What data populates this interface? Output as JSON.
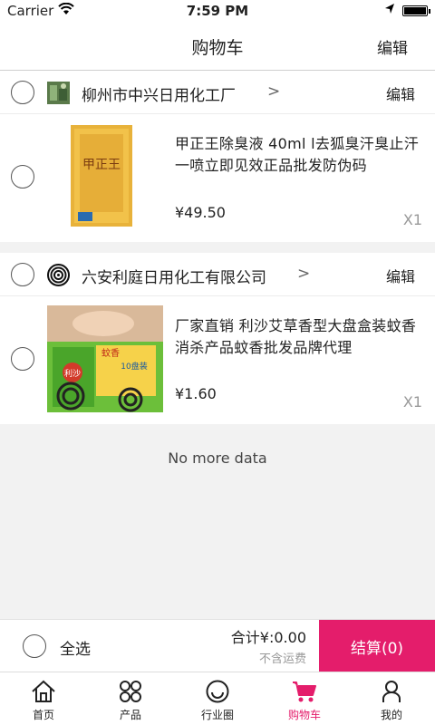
{
  "status_bar": {
    "carrier": "Carrier",
    "time": "7:59 PM"
  },
  "nav": {
    "title": "购物车",
    "edit": "编辑"
  },
  "shops": [
    {
      "name": "柳州市中兴日用化工厂",
      "edit": "编辑",
      "items": [
        {
          "title": "甲正王除臭液 40ml l去狐臭汗臭止汗一喷立即见效正品批发防伪码",
          "price": "¥49.50",
          "qty": "X1",
          "thumb_text": "甲正王"
        }
      ]
    },
    {
      "name": "六安利庭日用化工有限公司",
      "edit": "编辑",
      "items": [
        {
          "title": "厂家直销 利沙艾草香型大盘盒装蚊香消杀产品蚊香批发品牌代理",
          "price": "¥1.60",
          "qty": "X1",
          "thumb_text": "蚊香",
          "thumb_text2": "10盘装"
        }
      ]
    }
  ],
  "no_more": "No more data",
  "checkout": {
    "select_all": "全选",
    "total": "合计¥:0.00",
    "shipping": "不含运费",
    "pay_button": "结算(0)"
  },
  "tabs": [
    {
      "label": "首页",
      "icon": "home-icon"
    },
    {
      "label": "产品",
      "icon": "grid-icon"
    },
    {
      "label": "行业圈",
      "icon": "smile-icon"
    },
    {
      "label": "购物车",
      "icon": "cart-icon",
      "active": true
    },
    {
      "label": "我的",
      "icon": "person-icon"
    }
  ],
  "colors": {
    "accent": "#e41d6b"
  }
}
